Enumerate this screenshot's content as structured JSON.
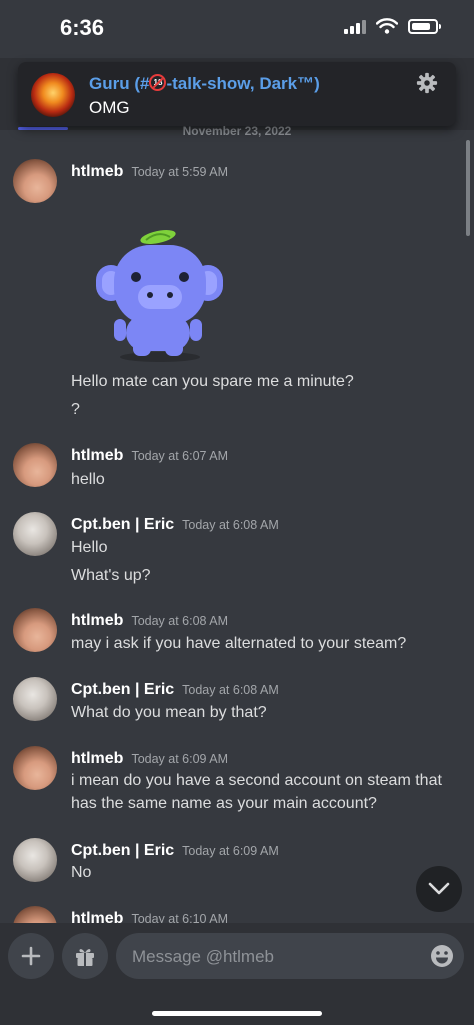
{
  "status_bar": {
    "time": "6:36",
    "battery_level": 0.8
  },
  "notification": {
    "title_prefix": "Guru (#",
    "age_badge": "18",
    "title_suffix": "-talk-show, Dark™)",
    "body": "OMG",
    "avatar_icon": "phoenix-avatar",
    "settings_icon": "gear-icon"
  },
  "date_divider": "November 23, 2022",
  "messages": [
    {
      "author": "htlmeb",
      "time": "Today at 5:59 AM",
      "sticker": "wumpus-sticker",
      "lines": [
        "Hello mate can you spare me a minute?",
        "?"
      ]
    },
    {
      "author": "htlmeb",
      "time": "Today at 6:07 AM",
      "lines": [
        "hello"
      ]
    },
    {
      "author": "Cpt.ben | Eric",
      "time": "Today at 6:08 AM",
      "lines": [
        "Hello",
        "What's up?"
      ]
    },
    {
      "author": "htlmeb",
      "time": "Today at 6:08 AM",
      "lines": [
        "may i ask if you have alternated to your steam?"
      ]
    },
    {
      "author": "Cpt.ben | Eric",
      "time": "Today at 6:08 AM",
      "lines": [
        "What do you mean by that?"
      ]
    },
    {
      "author": "htlmeb",
      "time": "Today at 6:09 AM",
      "lines": [
        "i mean do you have a second account on steam that has the same name as your main account?"
      ]
    },
    {
      "author": "Cpt.ben | Eric",
      "time": "Today at 6:09 AM",
      "lines": [
        "No"
      ]
    },
    {
      "author": "htlmeb",
      "time": "Today at 6:10 AM",
      "lines": []
    }
  ],
  "composer": {
    "placeholder": "Message @htlmeb",
    "add_icon": "plus-icon",
    "gift_icon": "gift-icon",
    "emoji_icon": "emoji-icon"
  },
  "jump_button_icon": "chevron-down-icon",
  "colors": {
    "background": "#36393f",
    "header": "#2f3136",
    "accent": "#5865f2",
    "link_name": "#5b9ee8"
  }
}
